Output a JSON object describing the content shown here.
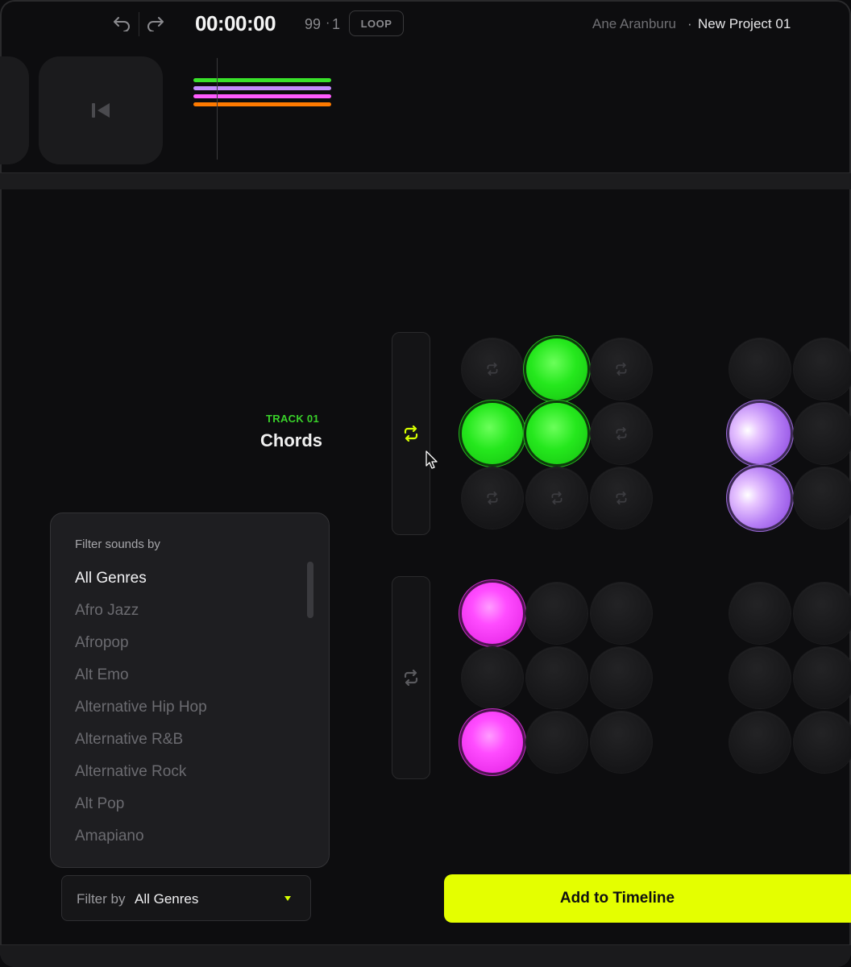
{
  "header": {
    "time": "00:00:00",
    "bpm": "99",
    "bar_sep": "·",
    "bar": "1",
    "loop_label": "LOOP",
    "user": "Ane Aranburu",
    "sep": "·",
    "project": "New Project 01"
  },
  "icons": {
    "undo": "undo-icon",
    "redo": "redo-icon",
    "rewind": "skip-back-icon",
    "loop": "repeat-icon"
  },
  "timeline_preview": {
    "colors": [
      "#39e22a",
      "#c48cff",
      "#ff5cff",
      "#ff7a00"
    ]
  },
  "track": {
    "number": "TRACK 01",
    "name": "Chords",
    "color": "#39d22a"
  },
  "filter_panel": {
    "heading": "Filter sounds by",
    "genres": [
      "All Genres",
      "Afro Jazz",
      "Afropop",
      "Alt Emo",
      "Alternative Hip Hop",
      "Alternative R&B",
      "Alternative Rock",
      "Alt Pop",
      "Amapiano"
    ],
    "selected": "All Genres"
  },
  "filter_select": {
    "label": "Filter by",
    "value": "All Genres"
  },
  "add_button": {
    "label": "Add to Timeline",
    "color": "#e4ff00"
  },
  "colors": {
    "green": "#25e81d",
    "purple": "#b780f5",
    "magenta": "#ff4cff",
    "accent_loop": "#d6ff00"
  }
}
